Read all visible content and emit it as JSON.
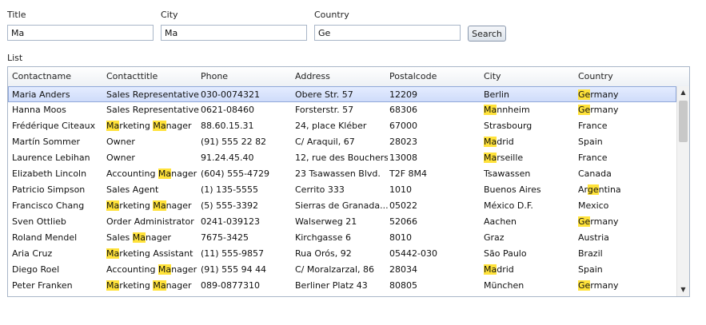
{
  "filters": {
    "title": {
      "label": "Title",
      "value": "Ma"
    },
    "city": {
      "label": "City",
      "value": "Ma"
    },
    "country": {
      "label": "Country",
      "value": "Ge"
    },
    "search_label": "Search"
  },
  "list_label": "List",
  "grid": {
    "columns": [
      "Contactname",
      "Contacttitle",
      "Phone",
      "Address",
      "Postalcode",
      "City",
      "Country"
    ],
    "selected_row": 0,
    "rows": [
      [
        "Maria Anders",
        "Sales Representative",
        "030-0074321",
        "Obere Str. 57",
        "12209",
        "Berlin",
        "Germany"
      ],
      [
        "Hanna Moos",
        "Sales Representative",
        "0621-08460",
        "Forsterstr. 57",
        "68306",
        "Mannheim",
        "Germany"
      ],
      [
        "Frédérique Citeaux",
        "Marketing Manager",
        "88.60.15.31",
        "24, place Kléber",
        "67000",
        "Strasbourg",
        "France"
      ],
      [
        "Martín Sommer",
        "Owner",
        "(91) 555 22 82",
        "C/ Araquil, 67",
        "28023",
        "Madrid",
        "Spain"
      ],
      [
        "Laurence Lebihan",
        "Owner",
        "91.24.45.40",
        "12, rue des Bouchers",
        "13008",
        "Marseille",
        "France"
      ],
      [
        "Elizabeth Lincoln",
        "Accounting Manager",
        "(604) 555-4729",
        "23 Tsawassen Blvd.",
        "T2F 8M4",
        "Tsawassen",
        "Canada"
      ],
      [
        "Patricio Simpson",
        "Sales Agent",
        "(1) 135-5555",
        "Cerrito 333",
        "1010",
        "Buenos Aires",
        "Argentina"
      ],
      [
        "Francisco Chang",
        "Marketing Manager",
        "(5) 555-3392",
        "Sierras de Granada...",
        "05022",
        "México D.F.",
        "Mexico"
      ],
      [
        "Sven Ottlieb",
        "Order Administrator",
        "0241-039123",
        "Walserweg 21",
        "52066",
        "Aachen",
        "Germany"
      ],
      [
        "Roland Mendel",
        "Sales Manager",
        "7675-3425",
        "Kirchgasse 6",
        "8010",
        "Graz",
        "Austria"
      ],
      [
        "Aria Cruz",
        "Marketing Assistant",
        "(11) 555-9857",
        "Rua Orós, 92",
        "05442-030",
        "São Paulo",
        "Brazil"
      ],
      [
        "Diego Roel",
        "Accounting Manager",
        "(91) 555 94 44",
        "C/ Moralzarzal, 86",
        "28034",
        "Madrid",
        "Spain"
      ],
      [
        "Peter Franken",
        "Marketing Manager",
        "089-0877310",
        "Berliner Platz 43",
        "80805",
        "München",
        "Germany"
      ]
    ]
  },
  "colors": {
    "highlight": "#ffe23a",
    "selection": "#cfdcfa",
    "border": "#a9b6c8"
  }
}
